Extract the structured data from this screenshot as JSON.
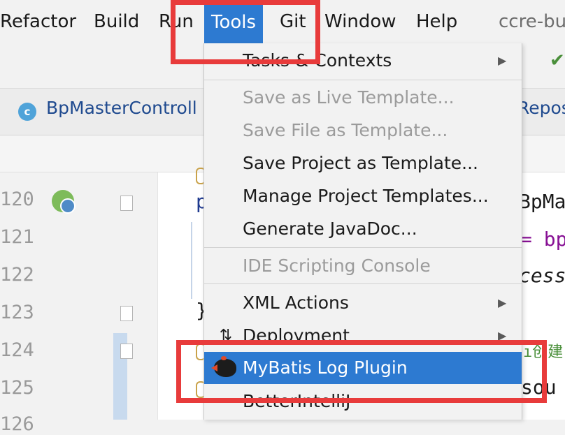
{
  "menubar": {
    "items": [
      {
        "id": "refactor",
        "label": "Refactor"
      },
      {
        "id": "build",
        "label": "Build"
      },
      {
        "id": "run",
        "label": "Run"
      },
      {
        "id": "tools",
        "label": "Tools"
      },
      {
        "id": "git",
        "label": "Git"
      },
      {
        "id": "window",
        "label": "Window"
      },
      {
        "id": "help",
        "label": "Help"
      }
    ],
    "project_title": "ccre-bu"
  },
  "tabs": {
    "active_label": "BpMasterControll",
    "active_icon": "class-c-icon",
    "right_label": "Repos"
  },
  "gutter": {
    "line_numbers": [
      "120",
      "121",
      "122",
      "123",
      "124",
      "125",
      "126"
    ]
  },
  "code": {
    "line120_left": "p",
    "line123_left": "}",
    "line120_right": "BpMa",
    "line121_right": "= bp",
    "line122_right": "cess",
    "line124_right": "ı创建",
    "line125_right": "sou"
  },
  "tools_menu": {
    "items": [
      {
        "label": "Tasks & Contexts",
        "enabled": true,
        "submenu": true
      },
      {
        "label": "Save as Live Template...",
        "enabled": false,
        "submenu": false
      },
      {
        "label": "Save File as Template...",
        "enabled": false,
        "submenu": false
      },
      {
        "label": "Save Project as Template...",
        "enabled": true,
        "submenu": false
      },
      {
        "label": "Manage Project Templates...",
        "enabled": true,
        "submenu": false
      },
      {
        "label": "Generate JavaDoc...",
        "enabled": true,
        "submenu": false
      },
      {
        "label": "IDE Scripting Console",
        "enabled": false,
        "submenu": false
      },
      {
        "label": "XML Actions",
        "enabled": true,
        "submenu": true
      },
      {
        "label": "Deployment",
        "enabled": true,
        "submenu": true
      },
      {
        "label": "MyBatis Log Plugin",
        "enabled": true,
        "submenu": false,
        "selected": true
      },
      {
        "label": "BetterIntelliJ",
        "enabled": true,
        "submenu": false
      }
    ]
  },
  "colors": {
    "menu_selected_bg": "#2d7ad1",
    "highlight_box": "#e83b3b",
    "disabled_text": "#9b9b9b"
  },
  "icons": {
    "deployment": "deployment-arrows-icon",
    "mybatis": "mybatis-bird-icon",
    "run_gutter": "run-gutter-icon",
    "vcs_update": "vcs-update-icon"
  }
}
